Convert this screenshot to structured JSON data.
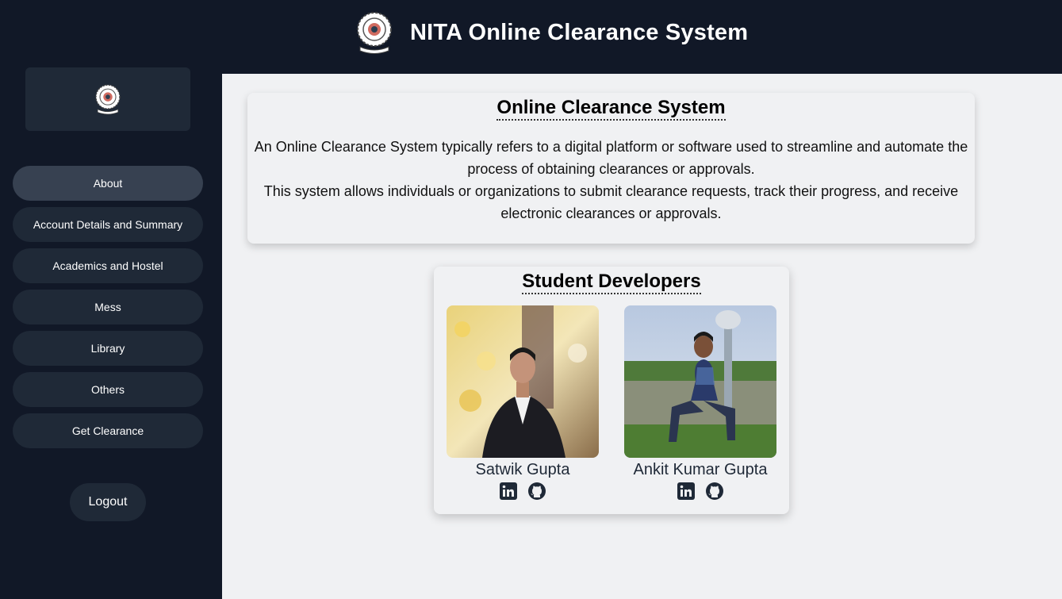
{
  "header": {
    "title": "NITA Online Clearance System",
    "logo_icon": "nita-emblem-icon"
  },
  "sidebar": {
    "logo_icon": "nita-emblem-icon",
    "items": [
      {
        "label": "About",
        "active": true
      },
      {
        "label": "Account Details and Summary",
        "active": false
      },
      {
        "label": "Academics and Hostel",
        "active": false
      },
      {
        "label": "Mess",
        "active": false
      },
      {
        "label": "Library",
        "active": false
      },
      {
        "label": "Others",
        "active": false
      },
      {
        "label": "Get Clearance",
        "active": false
      }
    ],
    "logout_label": "Logout"
  },
  "about": {
    "heading": "Online Clearance System",
    "paragraph1": "An Online Clearance System typically refers to a digital platform or software used to streamline and automate the process of obtaining clearances or approvals.",
    "paragraph2": "This system allows individuals or organizations to submit clearance requests, track their progress, and receive electronic clearances or approvals."
  },
  "developers": {
    "heading": "Student Developers",
    "people": [
      {
        "name": "Satwik Gupta",
        "links": [
          "linkedin-icon",
          "github-icon"
        ]
      },
      {
        "name": "Ankit Kumar Gupta",
        "links": [
          "linkedin-icon",
          "github-icon"
        ]
      }
    ]
  },
  "colors": {
    "sidebar_bg": "#111827",
    "nav_item_bg": "#1f2937",
    "nav_item_active_bg": "#374151",
    "content_bg": "#f0f1f3"
  }
}
